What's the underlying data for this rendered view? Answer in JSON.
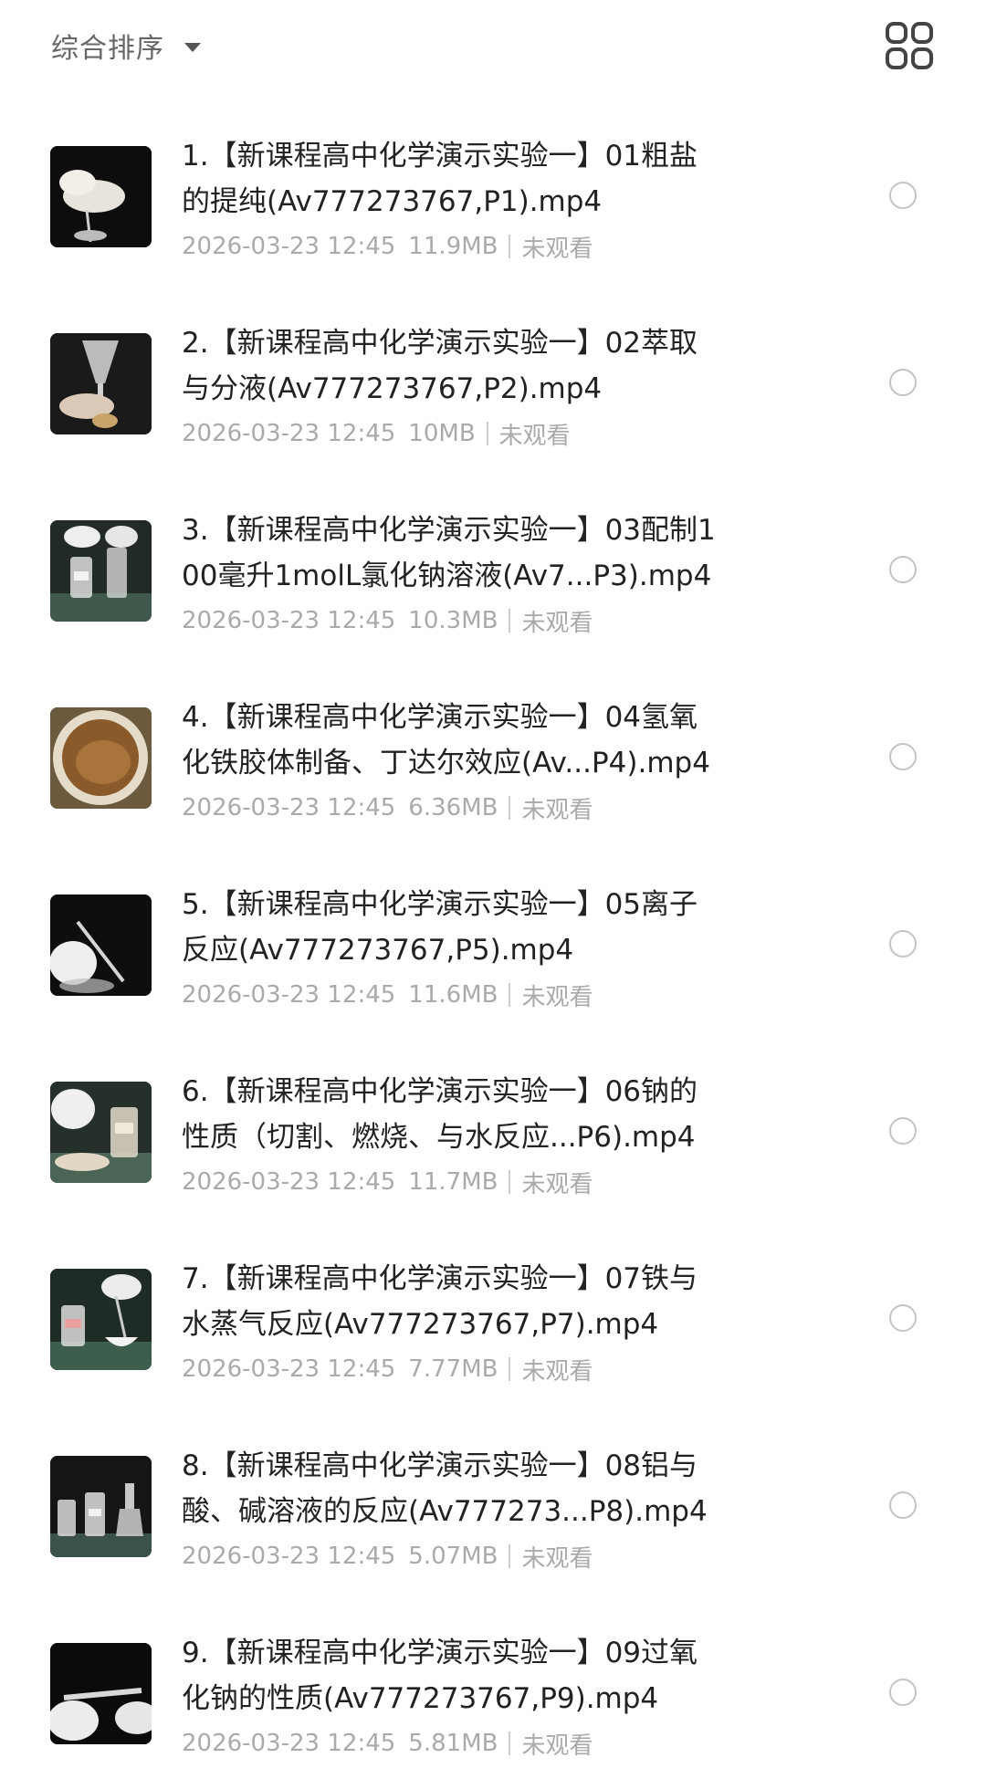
{
  "header": {
    "sort_label": "综合排序",
    "sort_icon": "caret-down-icon",
    "view_icon": "grid-view-icon"
  },
  "colors": {
    "title_text": "#222222",
    "meta_text": "#aaaaaa",
    "sort_text": "#666666",
    "radio_border": "#c4c4c4"
  },
  "items": [
    {
      "title_line1": "1.【新课程高中化学演示实验一】01粗盐",
      "title_line2": "的提纯(Av777273767,P1).mp4",
      "date": "2026-03-23 12:45",
      "size": "11.9MB",
      "status": "未观看",
      "thumb": "video-thumbnail"
    },
    {
      "title_line1": "2.【新课程高中化学演示实验一】02萃取",
      "title_line2": "与分液(Av777273767,P2).mp4",
      "date": "2026-03-23 12:45",
      "size": "10MB",
      "status": "未观看",
      "thumb": "video-thumbnail"
    },
    {
      "title_line1": "3.【新课程高中化学演示实验一】03配制1",
      "title_line2": "00毫升1molL氯化钠溶液(Av7...P3).mp4",
      "date": "2026-03-23 12:45",
      "size": "10.3MB",
      "status": "未观看",
      "thumb": "video-thumbnail"
    },
    {
      "title_line1": "4.【新课程高中化学演示实验一】04氢氧",
      "title_line2": "化铁胶体制备、丁达尔效应(Av...P4).mp4",
      "date": "2026-03-23 12:45",
      "size": "6.36MB",
      "status": "未观看",
      "thumb": "video-thumbnail"
    },
    {
      "title_line1": "5.【新课程高中化学演示实验一】05离子",
      "title_line2": "反应(Av777273767,P5).mp4",
      "date": "2026-03-23 12:45",
      "size": "11.6MB",
      "status": "未观看",
      "thumb": "video-thumbnail"
    },
    {
      "title_line1": "6.【新课程高中化学演示实验一】06钠的",
      "title_line2": "性质（切割、燃烧、与水反应...P6).mp4",
      "date": "2026-03-23 12:45",
      "size": "11.7MB",
      "status": "未观看",
      "thumb": "video-thumbnail"
    },
    {
      "title_line1": "7.【新课程高中化学演示实验一】07铁与",
      "title_line2": "水蒸气反应(Av777273767,P7).mp4",
      "date": "2026-03-23 12:45",
      "size": "7.77MB",
      "status": "未观看",
      "thumb": "video-thumbnail"
    },
    {
      "title_line1": "8.【新课程高中化学演示实验一】08铝与",
      "title_line2": "酸、碱溶液的反应(Av777273...P8).mp4",
      "date": "2026-03-23 12:45",
      "size": "5.07MB",
      "status": "未观看",
      "thumb": "video-thumbnail"
    },
    {
      "title_line1": "9.【新课程高中化学演示实验一】09过氧",
      "title_line2": "化钠的性质(Av777273767,P9).mp4",
      "date": "2026-03-23 12:45",
      "size": "5.81MB",
      "status": "未观看",
      "thumb": "video-thumbnail"
    }
  ]
}
